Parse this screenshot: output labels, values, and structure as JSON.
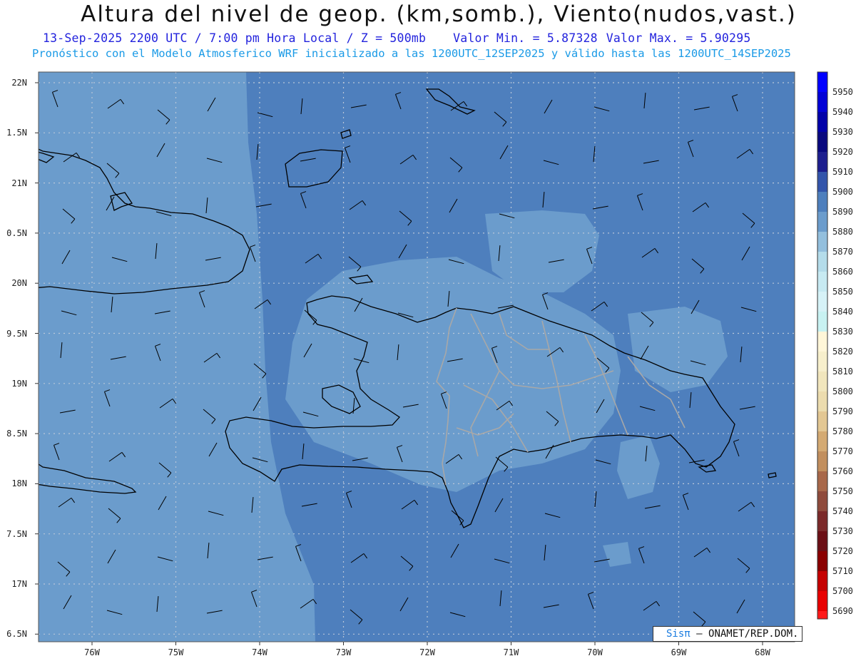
{
  "title": "Altura del nivel de geop. (km,somb.), Viento(nudos,vast.)",
  "subtitle": {
    "datetime": "13-Sep-2025  2200 UTC / 7:00 pm Hora Local / Z = 500mb",
    "min": "Valor Min. = 5.87328",
    "max": "Valor Max. = 5.90295"
  },
  "model_line": "Pronóstico con el Modelo Atmosferico WRF inicializado a las 1200UTC_12SEP2025 y válido hasta las  1200UTC_14SEP2025",
  "credit": {
    "sis": "Sisπ",
    "org": "– ONAMET/REP.DOM."
  },
  "chart_data": {
    "type": "heatmap",
    "field": "500mb geopotential height",
    "lon_range": [
      -76.65,
      -67.6
    ],
    "lat_range": [
      16.4,
      22.1
    ],
    "lon_ticks": [
      "76W",
      "75W",
      "74W",
      "73W",
      "72W",
      "71W",
      "70W",
      "69W",
      "68W"
    ],
    "lat_ticks": [
      "22N",
      "1.5N",
      "21N",
      "0.5N",
      "20N",
      "9.5N",
      "19N",
      "8.5N",
      "18N",
      "7.5N",
      "17N",
      "6.5N"
    ],
    "grid": true,
    "colorbar": {
      "levels": [
        5950,
        5940,
        5930,
        5920,
        5910,
        5900,
        5890,
        5880,
        5870,
        5860,
        5850,
        5840,
        5830,
        5820,
        5810,
        5800,
        5790,
        5780,
        5770,
        5760,
        5750,
        5740,
        5730,
        5720,
        5710,
        5700,
        5690
      ],
      "colors": [
        "#0000ff",
        "#0000d6",
        "#0000a8",
        "#08087e",
        "#1c1e8e",
        "#3355ab",
        "#4e7fbd",
        "#6b9ccc",
        "#93bfdd",
        "#b4dcea",
        "#c7eaf2",
        "#d6f2f7",
        "#c8f2f2",
        "#fff6d8",
        "#f7efcc",
        "#f1e6bd",
        "#ecdcae",
        "#e3c793",
        "#d4aa73",
        "#c28f5e",
        "#a8684a",
        "#8f4b3c",
        "#7b2a2a",
        "#6b0f15",
        "#8a0000",
        "#c50000",
        "#e80000"
      ],
      "bottom_color": "#ff1a1a"
    },
    "colors": {
      "background_field": "#4e7fbd",
      "lighter_field": "#6b9ccc",
      "boundaries": "#a8a8a8",
      "coast": "#000000"
    }
  }
}
